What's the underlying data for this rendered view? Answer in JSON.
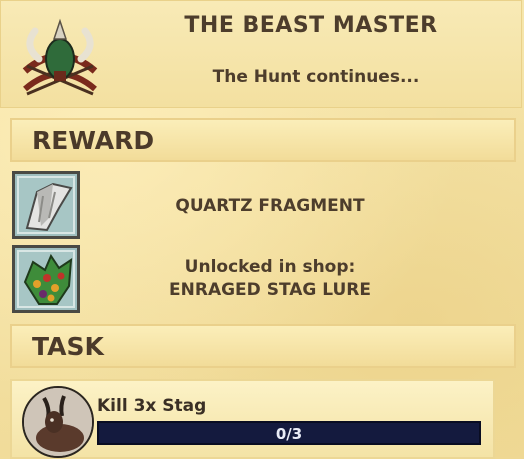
{
  "quest": {
    "title": "THE BEAST MASTER",
    "subtitle": "The Hunt continues..."
  },
  "reward": {
    "section_title": "REWARD",
    "items": [
      {
        "icon": "quartz-fragment-icon",
        "line1": "QUARTZ FRAGMENT"
      },
      {
        "icon": "berry-bush-icon",
        "line1": "Unlocked in shop:",
        "line2": "ENRAGED STAG LURE"
      }
    ]
  },
  "task": {
    "section_title": "TASK",
    "items": [
      {
        "icon": "stag-portrait-icon",
        "label": "Kill 3x Stag",
        "progress_text": "0/3",
        "progress_fraction": 0
      }
    ]
  },
  "colors": {
    "parchment": "#f4e2a3",
    "text": "#4d3d2c",
    "progress_bg": "#141a3e",
    "progress_fill": "#3c59b8"
  }
}
